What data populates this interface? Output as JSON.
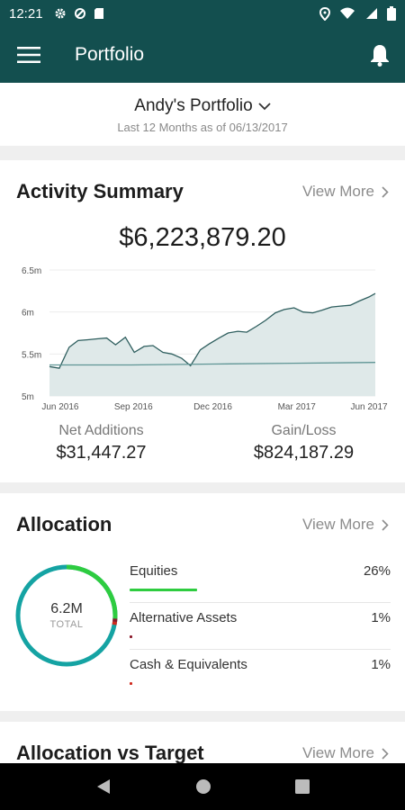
{
  "status_bar": {
    "time": "12:21"
  },
  "app_bar": {
    "title": "Portfolio"
  },
  "portfolio": {
    "name": "Andy's Portfolio",
    "subtitle": "Last 12 Months as of 06/13/2017"
  },
  "activity": {
    "title": "Activity Summary",
    "view_more": "View More",
    "total": "$6,223,879.20",
    "net_additions_label": "Net Additions",
    "net_additions_value": "$31,447.27",
    "gain_loss_label": "Gain/Loss",
    "gain_loss_value": "$824,187.29"
  },
  "chart_data": {
    "type": "area",
    "title": "",
    "xlabel": "",
    "ylabel": "",
    "ylim": [
      5.0,
      6.5
    ],
    "y_unit": "millions",
    "y_ticks": [
      "6.5m",
      "6m",
      "5.5m",
      "5m"
    ],
    "x_ticks": [
      "Jun 2016",
      "Sep 2016",
      "Dec 2016",
      "Mar 2017",
      "Jun 2017"
    ],
    "grid": true,
    "legend": "none",
    "series": [
      {
        "role": "market value",
        "color": "#2e5e5e",
        "fill": "#dfe9e9",
        "x": [
          "2016-06-13",
          "2016-06-24",
          "2016-07-05",
          "2016-07-15",
          "2016-07-26",
          "2016-08-05",
          "2016-08-16",
          "2016-08-26",
          "2016-09-06",
          "2016-09-16",
          "2016-09-27",
          "2016-10-07",
          "2016-10-18",
          "2016-10-28",
          "2016-11-08",
          "2016-11-18",
          "2016-11-29",
          "2016-12-09",
          "2016-12-20",
          "2016-12-30",
          "2017-01-10",
          "2017-01-20",
          "2017-01-31",
          "2017-02-10",
          "2017-02-21",
          "2017-03-03",
          "2017-03-14",
          "2017-03-24",
          "2017-04-04",
          "2017-04-14",
          "2017-04-25",
          "2017-05-05",
          "2017-05-16",
          "2017-05-26",
          "2017-06-06",
          "2017-06-13"
        ],
        "values": [
          5.35,
          5.33,
          5.58,
          5.66,
          5.67,
          5.68,
          5.69,
          5.61,
          5.7,
          5.52,
          5.59,
          5.6,
          5.52,
          5.5,
          5.45,
          5.36,
          5.55,
          5.62,
          5.69,
          5.75,
          5.77,
          5.76,
          5.83,
          5.9,
          5.99,
          6.03,
          6.05,
          6.0,
          5.99,
          6.02,
          6.06,
          6.07,
          6.08,
          6.13,
          6.18,
          6.22
        ]
      },
      {
        "role": "net additions baseline",
        "color": "#5f9595",
        "x": [
          "2016-06-13",
          "2016-09-13",
          "2016-12-13",
          "2017-03-13",
          "2017-06-13"
        ],
        "values": [
          5.37,
          5.37,
          5.38,
          5.39,
          5.4
        ]
      }
    ]
  },
  "allocation": {
    "title": "Allocation",
    "view_more": "View More",
    "donut_value": "6.2M",
    "donut_label": "TOTAL",
    "items": [
      {
        "name": "Equities",
        "pct": "26%",
        "fraction": 0.26,
        "color": "#2ecc40"
      },
      {
        "name": "Alternative Assets",
        "pct": "1%",
        "fraction": 0.01,
        "color": "#8b1a2b"
      },
      {
        "name": "Cash & Equivalents",
        "pct": "1%",
        "fraction": 0.01,
        "color": "#d02a1e"
      }
    ],
    "ring_color": "#15a3a3"
  },
  "allocation_target": {
    "title": "Allocation vs Target",
    "view_more": "View More"
  }
}
